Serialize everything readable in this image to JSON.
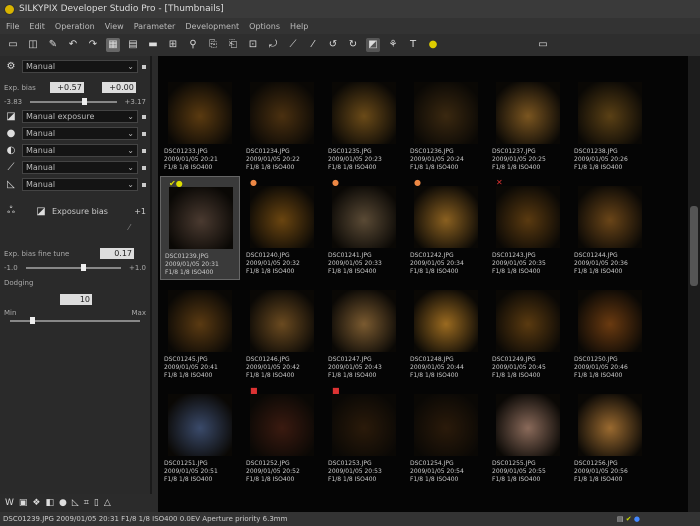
{
  "app": {
    "title": "SILKYPIX Developer Studio Pro - [Thumbnails]"
  },
  "menu": [
    "File",
    "Edit",
    "Operation",
    "View",
    "Parameter",
    "Development",
    "Options",
    "Help"
  ],
  "left_panel": {
    "top_select": "Manual",
    "exp_label": "Exp. bias",
    "exp_value1": "+0.57",
    "exp_value2": "+0.00",
    "range_min": "-3.83",
    "range_max": "+3.17",
    "selects": [
      "Manual exposure",
      "Manual",
      "Manual",
      "Manual",
      "Manual"
    ],
    "section_title": "Exposure bias",
    "section_badge": "+1",
    "bias_label": "Exp. bias fine tune",
    "bias_value": "0.17",
    "bias_min": "-1.0",
    "bias_max": "+1.0",
    "dodging_label": "Dodging",
    "dodging_value": "10",
    "dodging_min": "Min",
    "dodging_max": "Max"
  },
  "thumbnails": [
    {
      "name": "DSC01233.JPG",
      "date": "2009/01/05 20:21",
      "info": "F1/8 1/8 ISO400",
      "tone": "#5a3a10"
    },
    {
      "name": "DSC01234.JPG",
      "date": "2009/01/05 20:22",
      "info": "F1/8 1/8 ISO400",
      "tone": "#4a3010"
    },
    {
      "name": "DSC01235.JPG",
      "date": "2009/01/05 20:23",
      "info": "F1/8 1/8 ISO400",
      "tone": "#6a4a18"
    },
    {
      "name": "DSC01236.JPG",
      "date": "2009/01/05 20:24",
      "info": "F1/8 1/8 ISO400",
      "tone": "#3a2810"
    },
    {
      "name": "DSC01237.JPG",
      "date": "2009/01/05 20:25",
      "info": "F1/8 1/8 ISO400",
      "tone": "#7a5520"
    },
    {
      "name": "DSC01238.JPG",
      "date": "2009/01/05 20:26",
      "info": "F1/8 1/8 ISO400",
      "tone": "#5a4015"
    },
    {
      "name": "DSC01239.JPG",
      "date": "2009/01/05 20:31",
      "info": "F1/8 1/8 ISO400",
      "tone": "#4a3a30",
      "mark": "✔●",
      "sel": true
    },
    {
      "name": "DSC01240.JPG",
      "date": "2009/01/05 20:32",
      "info": "F1/8 1/8 ISO400",
      "tone": "#6a4510",
      "mark": "●"
    },
    {
      "name": "DSC01241.JPG",
      "date": "2009/01/05 20:33",
      "info": "F1/8 1/8 ISO400",
      "tone": "#5a4a35",
      "mark": "●"
    },
    {
      "name": "DSC01242.JPG",
      "date": "2009/01/05 20:34",
      "info": "F1/8 1/8 ISO400",
      "tone": "#8a6020",
      "mark": "●"
    },
    {
      "name": "DSC01243.JPG",
      "date": "2009/01/05 20:35",
      "info": "F1/8 1/8 ISO400",
      "tone": "#5a3a10",
      "mark": "✕"
    },
    {
      "name": "DSC01244.JPG",
      "date": "2009/01/05 20:36",
      "info": "F1/8 1/8 ISO400",
      "tone": "#6a4518"
    },
    {
      "name": "DSC01245.JPG",
      "date": "2009/01/05 20:41",
      "info": "F1/8 1/8 ISO400",
      "tone": "#5a3a12"
    },
    {
      "name": "DSC01246.JPG",
      "date": "2009/01/05 20:42",
      "info": "F1/8 1/8 ISO400",
      "tone": "#6a4a20"
    },
    {
      "name": "DSC01247.JPG",
      "date": "2009/01/05 20:43",
      "info": "F1/8 1/8 ISO400",
      "tone": "#7a5a30"
    },
    {
      "name": "DSC01248.JPG",
      "date": "2009/01/05 20:44",
      "info": "F1/8 1/8 ISO400",
      "tone": "#9a6a20"
    },
    {
      "name": "DSC01249.JPG",
      "date": "2009/01/05 20:45",
      "info": "F1/8 1/8 ISO400",
      "tone": "#5a3a10"
    },
    {
      "name": "DSC01250.JPG",
      "date": "2009/01/05 20:46",
      "info": "F1/8 1/8 ISO400",
      "tone": "#6a3a10"
    },
    {
      "name": "DSC01251.JPG",
      "date": "2009/01/05 20:51",
      "info": "F1/8 1/8 ISO400",
      "tone": "#3a4a6a"
    },
    {
      "name": "DSC01252.JPG",
      "date": "2009/01/05 20:52",
      "info": "F1/8 1/8 ISO400",
      "tone": "#3a1a10",
      "mark": "■"
    },
    {
      "name": "DSC01253.JPG",
      "date": "2009/01/05 20:53",
      "info": "F1/8 1/8 ISO400",
      "tone": "#2a1a0a",
      "mark": "■"
    },
    {
      "name": "DSC01254.JPG",
      "date": "2009/01/05 20:54",
      "info": "F1/8 1/8 ISO400",
      "tone": "#2a1a0a"
    },
    {
      "name": "DSC01255.JPG",
      "date": "2009/01/05 20:55",
      "info": "F1/8 1/8 ISO400",
      "tone": "#8a6a5a"
    },
    {
      "name": "DSC01256.JPG",
      "date": "2009/01/05 20:56",
      "info": "F1/8 1/8 ISO400",
      "tone": "#9a6a30"
    }
  ],
  "status": {
    "text": "DSC01239.JPG 2009/01/05 20:31 F1/8 1/8 ISO400 0.0EV Aperture priority 6.3mm"
  }
}
